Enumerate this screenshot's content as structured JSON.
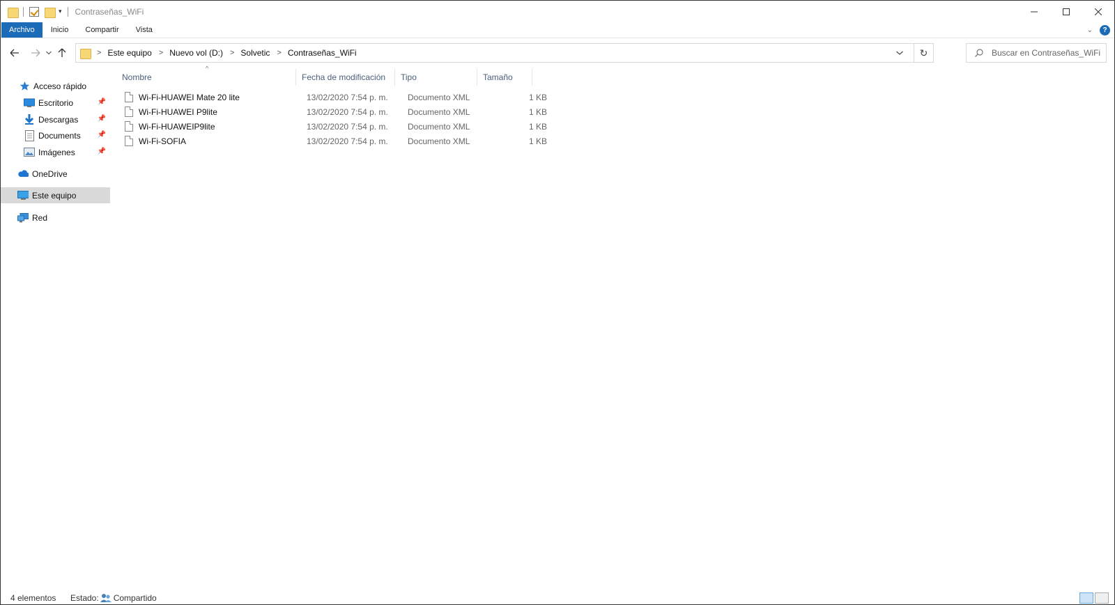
{
  "window": {
    "title": "Contraseñas_WiFi"
  },
  "ribbon": {
    "tabs": [
      "Archivo",
      "Inicio",
      "Compartir",
      "Vista"
    ],
    "file_tab_color": "#1c6bb8"
  },
  "address": {
    "crumbs": [
      "Este equipo",
      "Nuevo vol (D:)",
      "Solvetic",
      "Contraseñas_WiFi"
    ]
  },
  "search": {
    "placeholder": "Buscar en Contraseñas_WiFi"
  },
  "nav": {
    "quick_access": "Acceso rápido",
    "pinned": [
      {
        "label": "Escritorio",
        "icon": "desktop-icon"
      },
      {
        "label": "Descargas",
        "icon": "download-icon"
      },
      {
        "label": "Documents",
        "icon": "document-icon"
      },
      {
        "label": "Imágenes",
        "icon": "pictures-icon"
      }
    ],
    "onedrive": "OneDrive",
    "this_pc": "Este equipo",
    "network": "Red",
    "selected": "Este equipo"
  },
  "columns": {
    "name": "Nombre",
    "date": "Fecha de modificación",
    "type": "Tipo",
    "size": "Tamaño"
  },
  "files": [
    {
      "name": "Wi-Fi-HUAWEI Mate 20 lite",
      "date": "13/02/2020 7:54 p. m.",
      "type": "Documento XML",
      "size": "1 KB"
    },
    {
      "name": "Wi-Fi-HUAWEI P9lite",
      "date": "13/02/2020 7:54 p. m.",
      "type": "Documento XML",
      "size": "1 KB"
    },
    {
      "name": "Wi-Fi-HUAWEIP9lite",
      "date": "13/02/2020 7:54 p. m.",
      "type": "Documento XML",
      "size": "1 KB"
    },
    {
      "name": "Wi-Fi-SOFIA",
      "date": "13/02/2020 7:54 p. m.",
      "type": "Documento XML",
      "size": "1 KB"
    }
  ],
  "status": {
    "count": "4 elementos",
    "state_label": "Estado:",
    "state_value": "Compartido"
  }
}
